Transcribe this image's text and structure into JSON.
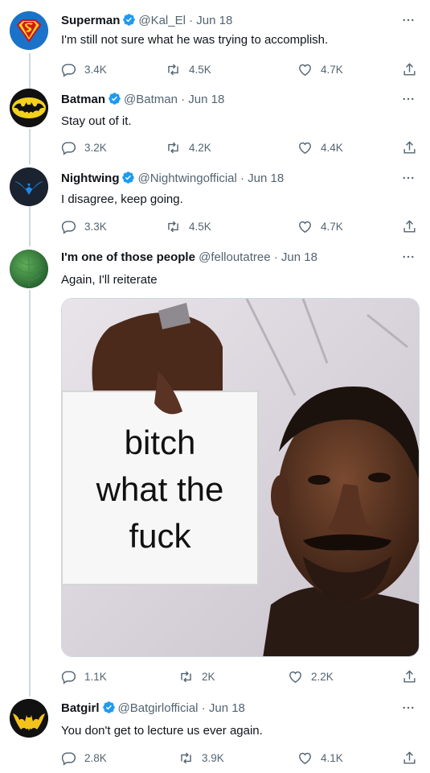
{
  "tweets": [
    {
      "name": "Superman",
      "handle": "@Kal_El",
      "date": "Jun 18",
      "text": "I'm still not sure what he was trying to accomplish.",
      "replies": "3.4K",
      "retweets": "4.5K",
      "likes": "4.7K",
      "verified": true
    },
    {
      "name": "Batman",
      "handle": "@Batman",
      "date": "Jun 18",
      "text": "Stay out of it.",
      "replies": "3.2K",
      "retweets": "4.2K",
      "likes": "4.4K",
      "verified": true
    },
    {
      "name": "Nightwing",
      "handle": "@Nightwingofficial",
      "date": "Jun 18",
      "text": "I disagree, keep going.",
      "replies": "3.3K",
      "retweets": "4.5K",
      "likes": "4.7K",
      "verified": true
    },
    {
      "name": "I'm one of those people",
      "handle": "@felloutatree",
      "date": "Jun 18",
      "text": "Again, I'll reiterate",
      "replies": "1.1K",
      "retweets": "2K",
      "likes": "2.2K",
      "verified": false,
      "media": {
        "sign_lines": [
          "bitch",
          "what the",
          "fuck"
        ]
      }
    },
    {
      "name": "Batgirl",
      "handle": "@Batgirlofficial",
      "date": "Jun 18",
      "text": "You don't get to lecture us ever again.",
      "replies": "2.8K",
      "retweets": "3.9K",
      "likes": "4.1K",
      "verified": true
    }
  ],
  "separator": "·",
  "colors": {
    "verified": "#1d9bf0",
    "secondary_text": "#536471",
    "thread_line": "#cfd9de"
  },
  "icons": {
    "reply": "reply-icon",
    "retweet": "retweet-icon",
    "like": "heart-icon",
    "share": "share-icon",
    "more": "more-icon"
  }
}
